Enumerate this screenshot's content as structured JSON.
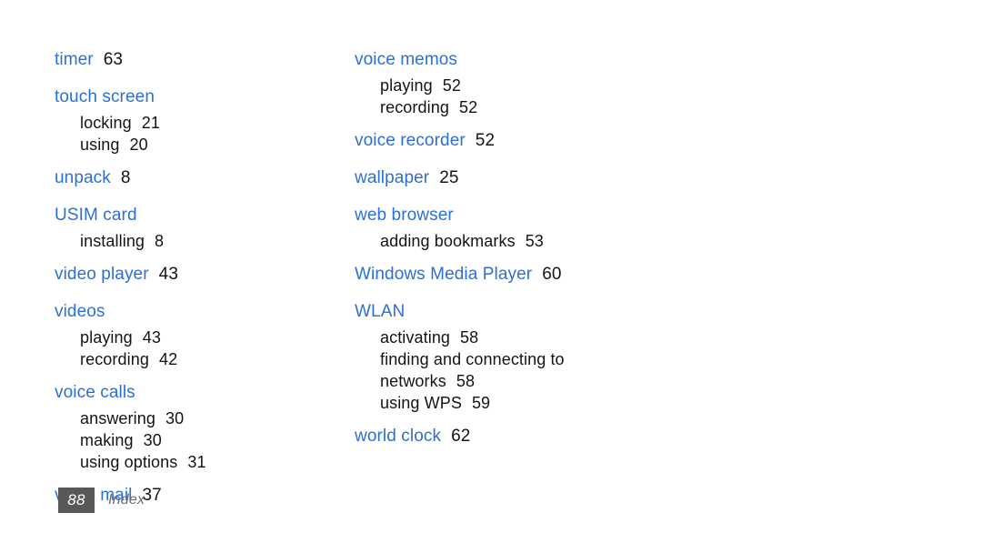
{
  "document": {
    "section_title": "Index",
    "page_number": "88",
    "accent_color": "#2c6fd6",
    "text_color": "#141414",
    "badge_color": "#585858",
    "footer_label_color": "#6b6b6b"
  },
  "columns": [
    {
      "id": "left",
      "groups": [
        {
          "term": "timer",
          "page": "63",
          "subs": []
        },
        {
          "term": "touch screen",
          "page": "",
          "subs": [
            {
              "term": "locking",
              "page": "21"
            },
            {
              "term": "using",
              "page": "20"
            }
          ]
        },
        {
          "term": "unpack",
          "page": "8",
          "subs": []
        },
        {
          "term": "USIM card",
          "page": "",
          "subs": [
            {
              "term": "installing",
              "page": "8"
            }
          ]
        },
        {
          "term": "video player",
          "page": "43",
          "subs": []
        },
        {
          "term": "videos",
          "page": "",
          "subs": [
            {
              "term": "playing",
              "page": "43"
            },
            {
              "term": "recording",
              "page": "42"
            }
          ]
        },
        {
          "term": "voice calls",
          "page": "",
          "subs": [
            {
              "term": "answering",
              "page": "30"
            },
            {
              "term": "making",
              "page": "30"
            },
            {
              "term": "using options",
              "page": "31"
            }
          ]
        },
        {
          "term": "voice mail",
          "page": "37",
          "subs": []
        }
      ]
    },
    {
      "id": "right",
      "groups": [
        {
          "term": "voice memos",
          "page": "",
          "subs": [
            {
              "term": "playing",
              "page": "52"
            },
            {
              "term": "recording",
              "page": "52"
            }
          ]
        },
        {
          "term": "voice recorder",
          "page": "52",
          "subs": []
        },
        {
          "term": "wallpaper",
          "page": "25",
          "subs": []
        },
        {
          "term": "web browser",
          "page": "",
          "subs": [
            {
              "term": "adding bookmarks",
              "page": "53"
            }
          ]
        },
        {
          "term": "Windows Media Player",
          "page": "60",
          "subs": []
        },
        {
          "term": "WLAN",
          "page": "",
          "subs": [
            {
              "term": "activating",
              "page": "58"
            },
            {
              "term": "finding and connecting to networks",
              "page": "58",
              "wrapped": true
            },
            {
              "term": "using WPS",
              "page": "59"
            }
          ]
        },
        {
          "term": "world clock",
          "page": "62",
          "subs": []
        }
      ]
    }
  ]
}
